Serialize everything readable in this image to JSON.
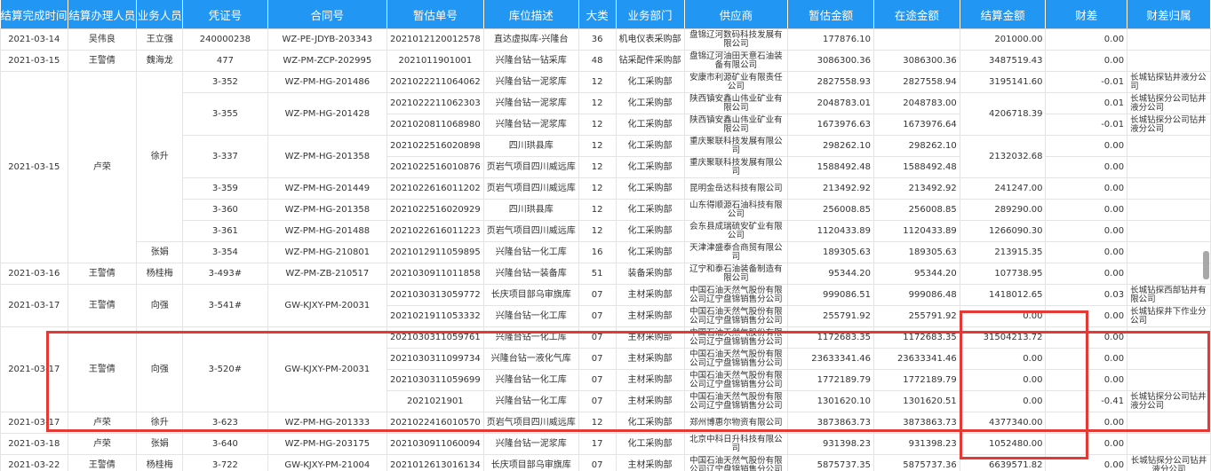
{
  "columns": [
    "结算完成时间",
    "结算办理人员",
    "业务人员",
    "凭证号",
    "合同号",
    "暂估单号",
    "库位描述",
    "大类",
    "业务部门",
    "供应商",
    "暂估金额",
    "在途金额",
    "结算金额",
    "财差",
    "财差归属"
  ],
  "rows": [
    {
      "date": "2021-03-14",
      "handler": "吴伟良",
      "staff": "王立强",
      "voucher": "240000238",
      "contract": "WZ-PE-JDYB-203343",
      "est_no": "2021012120012578",
      "loc": "直达虚拟库-兴隆台",
      "cat": "36",
      "dept": "机电仪表采购部",
      "supplier": "盘锦辽河数码科技发展有限公司",
      "est_amt": "177876.10",
      "transit": "",
      "settle": "201000.00",
      "diff": "0.00",
      "owner": ""
    },
    {
      "date": "2021-03-15",
      "handler": "王警倩",
      "staff": "魏海龙",
      "voucher": "477",
      "contract": "WZ-PM-ZCP-202995",
      "est_no": "2021011901001",
      "loc": "兴隆台钻一钻采库",
      "cat": "48",
      "dept": "钻采配件采购部",
      "supplier": "盘锦辽河油田天意石油装备有限公司",
      "est_amt": "3086300.36",
      "transit": "3086300.36",
      "settle": "3487519.43",
      "diff": "0.00",
      "owner": ""
    },
    {
      "date": "2021-03-15",
      "handler": "卢荣",
      "staff": "徐升",
      "voucher": "3-352",
      "contract": "WZ-PM-HG-201486",
      "est_no": "2021022211064062",
      "loc": "兴隆台钻一泥浆库",
      "cat": "12",
      "dept": "化工采购部",
      "supplier": "安康市利源矿业有限责任公司",
      "est_amt": "2827558.93",
      "transit": "2827558.94",
      "settle": "3195141.60",
      "diff": "-0.01",
      "owner": "长城钻探钻井液分公司"
    },
    {
      "date": "",
      "handler": "",
      "staff": "",
      "voucher": "3-355",
      "contract": "WZ-PM-HG-201428",
      "est_no": "2021022211062303",
      "loc": "兴隆台钻一泥浆库",
      "cat": "12",
      "dept": "化工采购部",
      "supplier": "陕西镇安鑫山伟业矿业有限公司",
      "est_amt": "2048783.01",
      "transit": "2048783.00",
      "settle": "4206718.39",
      "diff": "0.01",
      "owner": "长城钻探分公司钻井液分公司"
    },
    {
      "date": "",
      "handler": "",
      "staff": "",
      "voucher": "",
      "contract": "",
      "est_no": "2021020811068980",
      "loc": "兴隆台钻一泥浆库",
      "cat": "12",
      "dept": "化工采购部",
      "supplier": "陕西镇安鑫山伟业矿业有限公司",
      "est_amt": "1673976.63",
      "transit": "1673976.64",
      "settle": "",
      "diff": "-0.01",
      "owner": "长城钻探分公司钻井液分公司"
    },
    {
      "date": "",
      "handler": "",
      "staff": "",
      "voucher": "3-337",
      "contract": "WZ-PM-HG-201358",
      "est_no": "2021022516020898",
      "loc": "四川珙县库",
      "cat": "12",
      "dept": "化工采购部",
      "supplier": "重庆聚联科技发展有限公司",
      "est_amt": "298262.10",
      "transit": "298262.10",
      "settle": "2132032.68",
      "diff": "0.00",
      "owner": ""
    },
    {
      "date": "",
      "handler": "",
      "staff": "",
      "voucher": "",
      "contract": "",
      "est_no": "2021022516010876",
      "loc": "页岩气项目四川威远库",
      "cat": "12",
      "dept": "化工采购部",
      "supplier": "重庆聚联科技发展有限公司",
      "est_amt": "1588492.48",
      "transit": "1588492.48",
      "settle": "",
      "diff": "0.00",
      "owner": ""
    },
    {
      "date": "",
      "handler": "",
      "staff": "",
      "voucher": "3-359",
      "contract": "WZ-PM-HG-201449",
      "est_no": "2021022616011202",
      "loc": "页岩气项目四川威远库",
      "cat": "12",
      "dept": "化工采购部",
      "supplier": "昆明金岳达科技有限公司",
      "est_amt": "213492.92",
      "transit": "213492.92",
      "settle": "241247.00",
      "diff": "0.00",
      "owner": ""
    },
    {
      "date": "",
      "handler": "",
      "staff": "",
      "voucher": "3-360",
      "contract": "WZ-PM-HG-201358",
      "est_no": "2021022516020929",
      "loc": "四川珙县库",
      "cat": "12",
      "dept": "化工采购部",
      "supplier": "山东得顺源石油科技有限公司",
      "est_amt": "256008.85",
      "transit": "256008.85",
      "settle": "289290.00",
      "diff": "0.00",
      "owner": ""
    },
    {
      "date": "",
      "handler": "",
      "staff": "",
      "voucher": "3-361",
      "contract": "WZ-PM-HG-201488",
      "est_no": "2021022616011223",
      "loc": "页岩气项目四川威远库",
      "cat": "12",
      "dept": "化工采购部",
      "supplier": "会东县成瑞硫安矿业有限公司",
      "est_amt": "1120433.89",
      "transit": "1120433.89",
      "settle": "1266090.30",
      "diff": "0.00",
      "owner": ""
    },
    {
      "date": "",
      "handler": "",
      "staff": "张娟",
      "voucher": "3-354",
      "contract": "WZ-PM-HG-210801",
      "est_no": "2021012911059895",
      "loc": "兴隆台钻一化工库",
      "cat": "16",
      "dept": "化工采购部",
      "supplier": "天津津盛泰合商贸有限公司",
      "est_amt": "189305.63",
      "transit": "189305.63",
      "settle": "213915.35",
      "diff": "0.00",
      "owner": ""
    },
    {
      "date": "2021-03-16",
      "handler": "王警倩",
      "staff": "杨桂梅",
      "voucher": "3-493#",
      "contract": "WZ-PM-ZB-210517",
      "est_no": "2021030911011858",
      "loc": "兴隆台钻一装备库",
      "cat": "51",
      "dept": "装备采购部",
      "supplier": "辽宁和泰石油装备制造有限公司",
      "est_amt": "95344.20",
      "transit": "95344.20",
      "settle": "107738.95",
      "diff": "0.00",
      "owner": ""
    },
    {
      "date": "2021-03-17",
      "handler": "王警倩",
      "staff": "向强",
      "voucher": "3-541#",
      "contract": "GW-KJXY-PM-20031",
      "est_no": "2021030313059772",
      "loc": "长庆项目部乌审旗库",
      "cat": "07",
      "dept": "主材采购部",
      "supplier": "中国石油天然气股份有限公司辽宁盘锦销售分公司",
      "est_amt": "999086.51",
      "transit": "999086.48",
      "settle": "1418012.65",
      "diff": "0.03",
      "owner": "长城钻探西部钻井有限公司"
    },
    {
      "date": "",
      "handler": "",
      "staff": "",
      "voucher": "",
      "contract": "",
      "est_no": "2021021911053332",
      "loc": "兴隆台钻一化工库",
      "cat": "07",
      "dept": "主材采购部",
      "supplier": "中国石油天然气股份有限公司辽宁盘锦销售分公司",
      "est_amt": "255791.92",
      "transit": "255791.92",
      "settle": "0.00",
      "diff": "0.00",
      "owner": "长城钻探井下作业分公司"
    },
    {
      "date": "2021-03-17",
      "handler": "王警倩",
      "staff": "向强",
      "voucher": "3-520#",
      "contract": "GW-KJXY-PM-20031",
      "est_no": "2021030311059761",
      "loc": "兴隆台钻一化工库",
      "cat": "07",
      "dept": "主材采购部",
      "supplier": "中国石油天然气股份有限公司辽宁盘锦销售分公司",
      "est_amt": "1172683.35",
      "transit": "1172683.35",
      "settle": "31504213.72",
      "diff": "0.00",
      "owner": ""
    },
    {
      "date": "",
      "handler": "",
      "staff": "",
      "voucher": "",
      "contract": "",
      "est_no": "2021030311099734",
      "loc": "兴隆台钻一液化气库",
      "cat": "07",
      "dept": "主材采购部",
      "supplier": "中国石油天然气股份有限公司辽宁盘锦销售分公司",
      "est_amt": "23633341.46",
      "transit": "23633341.46",
      "settle": "0.00",
      "diff": "0.00",
      "owner": ""
    },
    {
      "date": "",
      "handler": "",
      "staff": "",
      "voucher": "",
      "contract": "",
      "est_no": "2021030311059699",
      "loc": "兴隆台钻一化工库",
      "cat": "07",
      "dept": "主材采购部",
      "supplier": "中国石油天然气股份有限公司辽宁盘锦销售分公司",
      "est_amt": "1772189.79",
      "transit": "1772189.79",
      "settle": "0.00",
      "diff": "0.00",
      "owner": ""
    },
    {
      "date": "",
      "handler": "",
      "staff": "",
      "voucher": "",
      "contract": "",
      "est_no": "2021021901",
      "loc": "兴隆台钻一化工库",
      "cat": "07",
      "dept": "主材采购部",
      "supplier": "中国石油天然气股份有限公司辽宁盘锦销售分公司",
      "est_amt": "1301620.10",
      "transit": "1301620.51",
      "settle": "0.00",
      "diff": "-0.41",
      "owner": "长城钻探分公司钻井液分公司"
    },
    {
      "date": "2021-03-17",
      "handler": "卢荣",
      "staff": "徐升",
      "voucher": "3-623",
      "contract": "WZ-PM-HG-201333",
      "est_no": "2021022416010570",
      "loc": "页岩气项目四川威远库",
      "cat": "12",
      "dept": "化工采购部",
      "supplier": "郑州博惠尔物资有限公司",
      "est_amt": "3873863.73",
      "transit": "3873863.73",
      "settle": "4377340.00",
      "diff": "0.00",
      "owner": ""
    },
    {
      "date": "2021-03-18",
      "handler": "卢荣",
      "staff": "张娟",
      "voucher": "3-640",
      "contract": "WZ-PM-HG-203175",
      "est_no": "2021030911060094",
      "loc": "兴隆台钻一泥浆库",
      "cat": "17",
      "dept": "化工采购部",
      "supplier": "北京中科日升科技有限公司",
      "est_amt": "931398.23",
      "transit": "931398.23",
      "settle": "1052480.00",
      "diff": "0.00",
      "owner": ""
    },
    {
      "date": "2021-03-22",
      "handler": "王警倩",
      "staff": "杨桂梅",
      "voucher": "3-722",
      "contract": "GW-KJXY-PM-21004",
      "est_no": "2021012613016134",
      "loc": "长庆项目部乌审旗库",
      "cat": "07",
      "dept": "主材采购部",
      "supplier": "中国石油天然气股份有限公司辽宁盘锦销售分公司",
      "est_amt": "5875737.35",
      "transit": "5875737.36",
      "settle": "6639571.82",
      "diff": "0.00",
      "owner": "长城钻探分公司钻井液分公司"
    }
  ]
}
